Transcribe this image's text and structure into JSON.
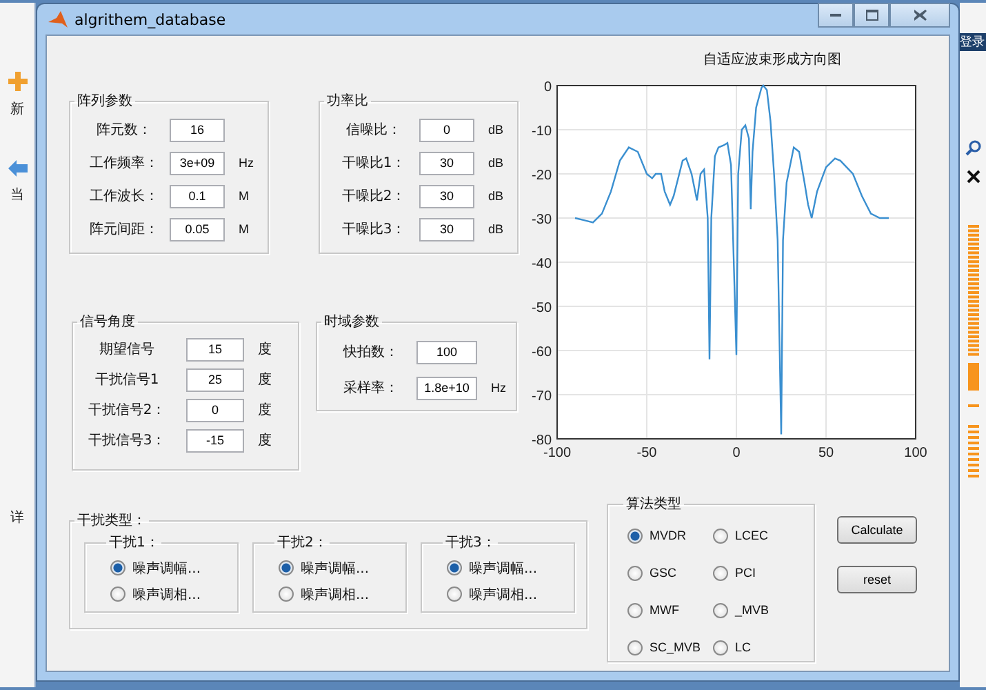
{
  "background_app": {
    "left_texts": [
      "新",
      "当",
      "详"
    ],
    "right_text": "登录"
  },
  "window": {
    "title": "algrithem_database"
  },
  "array_params": {
    "title": "阵列参数",
    "rows": [
      {
        "label": "阵元数：",
        "value": "16"
      },
      {
        "label": "工作频率：",
        "value": "3e+09",
        "unit": "Hz"
      },
      {
        "label": "工作波长：",
        "value": "0.1",
        "unit": "M"
      },
      {
        "label": "阵元间距：",
        "value": "0.05",
        "unit": "M"
      }
    ]
  },
  "power_ratio": {
    "title": "功率比",
    "rows": [
      {
        "label": "信噪比：",
        "value": "0",
        "unit": "dB"
      },
      {
        "label": "干噪比1：",
        "value": "30",
        "unit": "dB"
      },
      {
        "label": "干噪比2：",
        "value": "30",
        "unit": "dB"
      },
      {
        "label": "干噪比3：",
        "value": "30",
        "unit": "dB"
      }
    ]
  },
  "signal_angles": {
    "title": "信号角度",
    "rows": [
      {
        "label": "期望信号",
        "value": "15",
        "unit": "度"
      },
      {
        "label": "干扰信号1",
        "value": "25",
        "unit": "度"
      },
      {
        "label": "干扰信号2：",
        "value": "0",
        "unit": "度"
      },
      {
        "label": "干扰信号3：",
        "value": "-15",
        "unit": "度"
      }
    ]
  },
  "time_params": {
    "title": "时域参数",
    "rows": [
      {
        "label": "快拍数：",
        "value": "100"
      },
      {
        "label": "采样率：",
        "value": "1.8e+10",
        "unit": "Hz"
      }
    ]
  },
  "interference_type": {
    "title": "干扰类型：",
    "groups": [
      {
        "title": "干扰1：",
        "options": [
          {
            "label": "噪声调幅...",
            "selected": true
          },
          {
            "label": "噪声调相...",
            "selected": false
          }
        ]
      },
      {
        "title": "干扰2：",
        "options": [
          {
            "label": "噪声调幅...",
            "selected": true
          },
          {
            "label": "噪声调相...",
            "selected": false
          }
        ]
      },
      {
        "title": "干扰3：",
        "options": [
          {
            "label": "噪声调幅...",
            "selected": true
          },
          {
            "label": "噪声调相...",
            "selected": false
          }
        ]
      }
    ]
  },
  "chart": {
    "chart_data": {
      "type": "line",
      "title": "自适应波束形成方向图",
      "grid": true,
      "xlim": [
        -100,
        100
      ],
      "ylim": [
        -80,
        0
      ],
      "xticks": [
        -100,
        -50,
        0,
        50,
        100
      ],
      "yticks": [
        -80,
        -70,
        -60,
        -50,
        -40,
        -30,
        -20,
        -10,
        0
      ],
      "x": [
        -90,
        -85,
        -80,
        -75,
        -70,
        -65,
        -60,
        -55,
        -50,
        -47,
        -45,
        -42,
        -40,
        -37,
        -35,
        -30,
        -28,
        -25,
        -22,
        -20,
        -18,
        -16,
        -15,
        -14,
        -12,
        -10,
        -7,
        -5,
        -3,
        0,
        1,
        3,
        5,
        7,
        8,
        9,
        11,
        14,
        15,
        17,
        19,
        21,
        23,
        25,
        26,
        28,
        32,
        35,
        38,
        40,
        42,
        45,
        50,
        55,
        58,
        65,
        70,
        75,
        80,
        85
      ],
      "series": [
        {
          "color": "#3a8fd0",
          "values": [
            -30,
            -30.5,
            -31,
            -29,
            -24,
            -17,
            -14,
            -15,
            -20,
            -21,
            -20,
            -20,
            -24,
            -27,
            -25,
            -17,
            -16.5,
            -20,
            -26,
            -20,
            -19,
            -30,
            -62,
            -30,
            -16,
            -14,
            -13.5,
            -13,
            -18,
            -61,
            -20,
            -10,
            -9,
            -12,
            -28,
            -15,
            -5,
            -0.5,
            0,
            -1,
            -8,
            -20,
            -35,
            -79,
            -35,
            -22,
            -14,
            -15,
            -22,
            -27,
            -30,
            -24,
            -18.5,
            -16.5,
            -17,
            -20,
            -25,
            -29,
            -30,
            -30
          ]
        }
      ]
    }
  },
  "algorithm": {
    "title": "算法类型",
    "options": [
      {
        "label": "MVDR",
        "selected": true
      },
      {
        "label": "LCEC",
        "selected": false
      },
      {
        "label": "GSC",
        "selected": false
      },
      {
        "label": "PCI",
        "selected": false
      },
      {
        "label": "MWF",
        "selected": false
      },
      {
        "label": "_MVB",
        "selected": false
      },
      {
        "label": "SC_MVB",
        "selected": false
      },
      {
        "label": "LC",
        "selected": false
      }
    ]
  },
  "buttons": [
    "Calculate",
    "reset"
  ]
}
